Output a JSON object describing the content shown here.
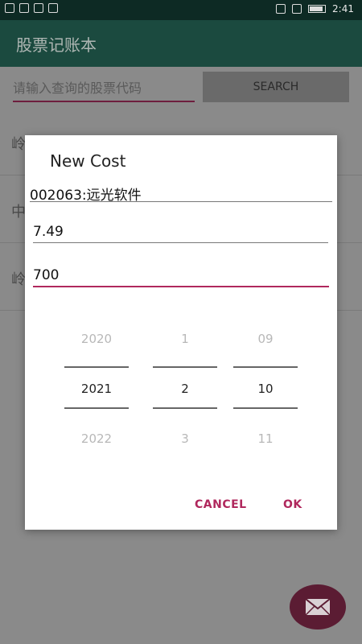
{
  "status_bar": {
    "time": "2:41",
    "left_icons": [
      "hd-icon",
      "signal-icon",
      "wifi-icon",
      "app-icon"
    ],
    "right_icons": [
      "nfc-icon",
      "alarm-icon",
      "battery-icon"
    ]
  },
  "app_bar": {
    "title": "股票记账本"
  },
  "search": {
    "placeholder": "请输入查询的股票代码",
    "button_label": "SEARCH"
  },
  "list": {
    "items": [
      {
        "label": "岭"
      },
      {
        "label": "中"
      },
      {
        "label": "岭"
      }
    ]
  },
  "dialog": {
    "title": "New Cost",
    "stock_field": {
      "value": "002063:远光软件"
    },
    "price_field": {
      "value": "7.49"
    },
    "quantity_field": {
      "value": "700"
    },
    "date_picker": {
      "year": {
        "prev": "2020",
        "selected": "2021",
        "next": "2022"
      },
      "month": {
        "prev": "1",
        "selected": "2",
        "next": "3"
      },
      "day": {
        "prev": "09",
        "selected": "10",
        "next": "11"
      }
    },
    "cancel_label": "CANCEL",
    "ok_label": "OK"
  },
  "colors": {
    "accent": "#b0285d",
    "app_bar": "#1b4a3f",
    "fab": "#5b1c33"
  }
}
